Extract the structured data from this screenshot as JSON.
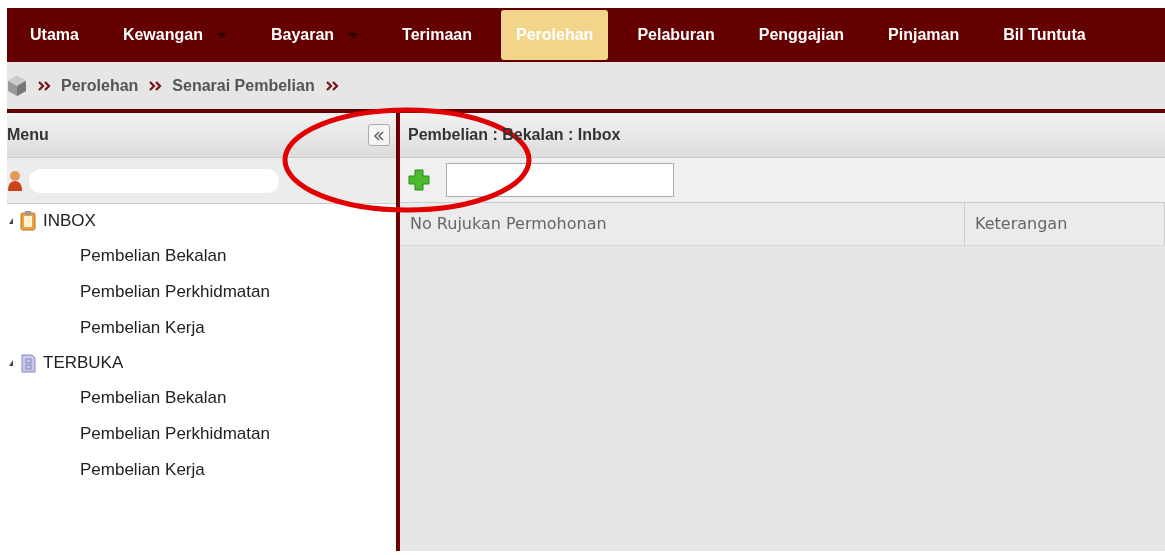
{
  "nav": [
    {
      "label": "Utama",
      "selected": false,
      "dropdown": false
    },
    {
      "label": "Kewangan",
      "selected": false,
      "dropdown": true
    },
    {
      "label": "Bayaran",
      "selected": false,
      "dropdown": true
    },
    {
      "label": "Terimaan",
      "selected": false,
      "dropdown": false
    },
    {
      "label": "Perolehan",
      "selected": true,
      "dropdown": false
    },
    {
      "label": "Pelaburan",
      "selected": false,
      "dropdown": false
    },
    {
      "label": "Penggajian",
      "selected": false,
      "dropdown": false
    },
    {
      "label": "Pinjaman",
      "selected": false,
      "dropdown": false
    },
    {
      "label": "Bil Tuntuta",
      "selected": false,
      "dropdown": false
    }
  ],
  "breadcrumb": [
    "Perolehan",
    "Senarai Pembelian"
  ],
  "sidebar": {
    "title": "Menu",
    "tree": [
      {
        "label": "INBOX",
        "kind": "clipboard",
        "expanded": true,
        "children": [
          {
            "label": "Pembelian Bekalan"
          },
          {
            "label": "Pembelian Perkhidmatan"
          },
          {
            "label": "Pembelian Kerja"
          }
        ]
      },
      {
        "label": "TERBUKA",
        "kind": "cabinet",
        "expanded": true,
        "children": [
          {
            "label": "Pembelian Bekalan"
          },
          {
            "label": "Pembelian Perkhidmatan"
          },
          {
            "label": "Pembelian Kerja"
          }
        ]
      }
    ]
  },
  "panel": {
    "title": "Pembelian : Bekalan : Inbox",
    "table": {
      "columns": [
        "No Rujukan Permohonan",
        "Keterangan"
      ]
    }
  }
}
